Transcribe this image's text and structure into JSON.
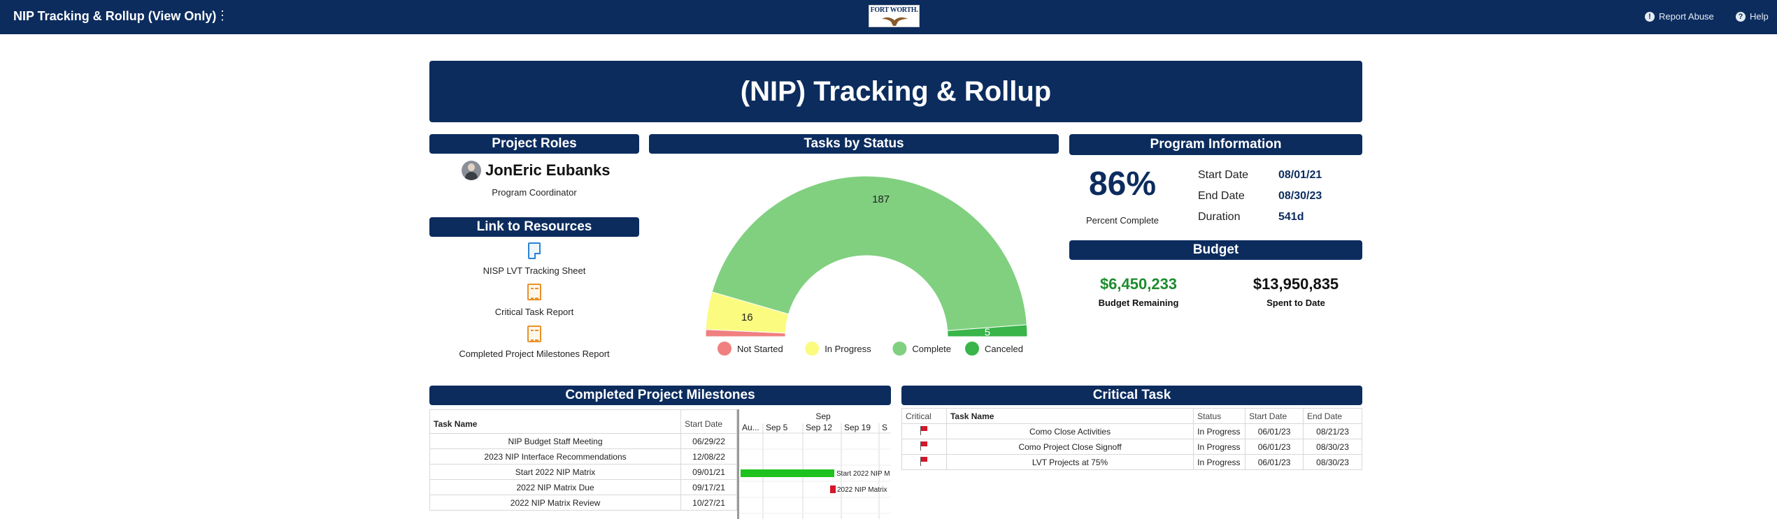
{
  "topbar": {
    "title": "NIP Tracking & Rollup (View Only)",
    "menu_glyph": "⋮",
    "logo_text": "FORT WORTH.",
    "report_abuse": "Report Abuse",
    "help": "Help",
    "colors": {
      "bar": "#0c2c5e"
    }
  },
  "banner": {
    "title": "(NIP) Tracking & Rollup"
  },
  "project_roles": {
    "header": "Project Roles",
    "name": "JonEric Eubanks",
    "role": "Program Coordinator"
  },
  "resources": {
    "header": "Link to Resources",
    "items": [
      {
        "label": "NISP LVT Tracking Sheet",
        "icon": "document-icon"
      },
      {
        "label": "Critical Task Report",
        "icon": "report-icon"
      },
      {
        "label": "Completed Project Milestones Report",
        "icon": "report-icon"
      }
    ]
  },
  "tasks_by_status": {
    "header": "Tasks by Status"
  },
  "chart_data": {
    "type": "pie",
    "subtype": "half-donut",
    "title": "Tasks by Status",
    "legend_position": "bottom",
    "series": [
      {
        "name": "Not Started",
        "value": 3,
        "color": "#f08080",
        "label": ""
      },
      {
        "name": "In Progress",
        "value": 16,
        "color": "#fbfb80",
        "label": "16"
      },
      {
        "name": "Complete",
        "value": 187,
        "color": "#80d080",
        "label": "187"
      },
      {
        "name": "Canceled",
        "value": 5,
        "color": "#39b54a",
        "label": "5"
      }
    ]
  },
  "program_info": {
    "header": "Program Information",
    "percent": "86%",
    "percent_label": "Percent Complete",
    "rows": [
      {
        "key": "Start Date",
        "value": "08/01/21"
      },
      {
        "key": "End Date",
        "value": "08/30/23"
      },
      {
        "key": "Duration",
        "value": "541d"
      }
    ]
  },
  "budget": {
    "header": "Budget",
    "remaining": "$6,450,233",
    "remaining_label": "Budget Remaining",
    "spent": "$13,950,835",
    "spent_label": "Spent to Date",
    "colors": {
      "remaining": "#1e8c2e",
      "spent": "#111111"
    }
  },
  "milestones": {
    "header": "Completed Project Milestones",
    "columns": {
      "task": "Task Name",
      "start": "Start Date"
    },
    "gantt": {
      "month": "Sep",
      "weeks": [
        "Au...",
        "Sep 5",
        "Sep 12",
        "Sep 19",
        "S"
      ]
    },
    "rows": [
      {
        "task": "NIP Budget Staff Meeting",
        "start": "06/29/22",
        "bar_label": "",
        "bar_kind": "none"
      },
      {
        "task": "2023 NIP Interface Recommendations",
        "start": "12/08/22",
        "bar_label": "",
        "bar_kind": "none"
      },
      {
        "task": "Start 2022 NIP Matrix",
        "start": "09/01/21",
        "bar_label": "Start 2022 NIP M",
        "bar_kind": "range"
      },
      {
        "task": "2022 NIP Matrix Due",
        "start": "09/17/21",
        "bar_label": "2022 NIP Matrix",
        "bar_kind": "milestone"
      },
      {
        "task": "2022 NIP Matrix Review",
        "start": "10/27/21",
        "bar_label": "",
        "bar_kind": "none"
      }
    ],
    "colors": {
      "range": "#1ec21e",
      "milestone": "#d5162b"
    }
  },
  "critical": {
    "header": "Critical Task",
    "columns": [
      "Critical",
      "Task Name",
      "Status",
      "Start Date",
      "End Date"
    ],
    "rows": [
      {
        "task": "Como Close Activities",
        "status": "In Progress",
        "start": "06/01/23",
        "end": "08/21/23"
      },
      {
        "task": "Como Project Close Signoff",
        "status": "In Progress",
        "start": "06/01/23",
        "end": "08/30/23"
      },
      {
        "task": "LVT Projects at 75%",
        "status": "In Progress",
        "start": "06/01/23",
        "end": "08/30/23"
      }
    ]
  }
}
